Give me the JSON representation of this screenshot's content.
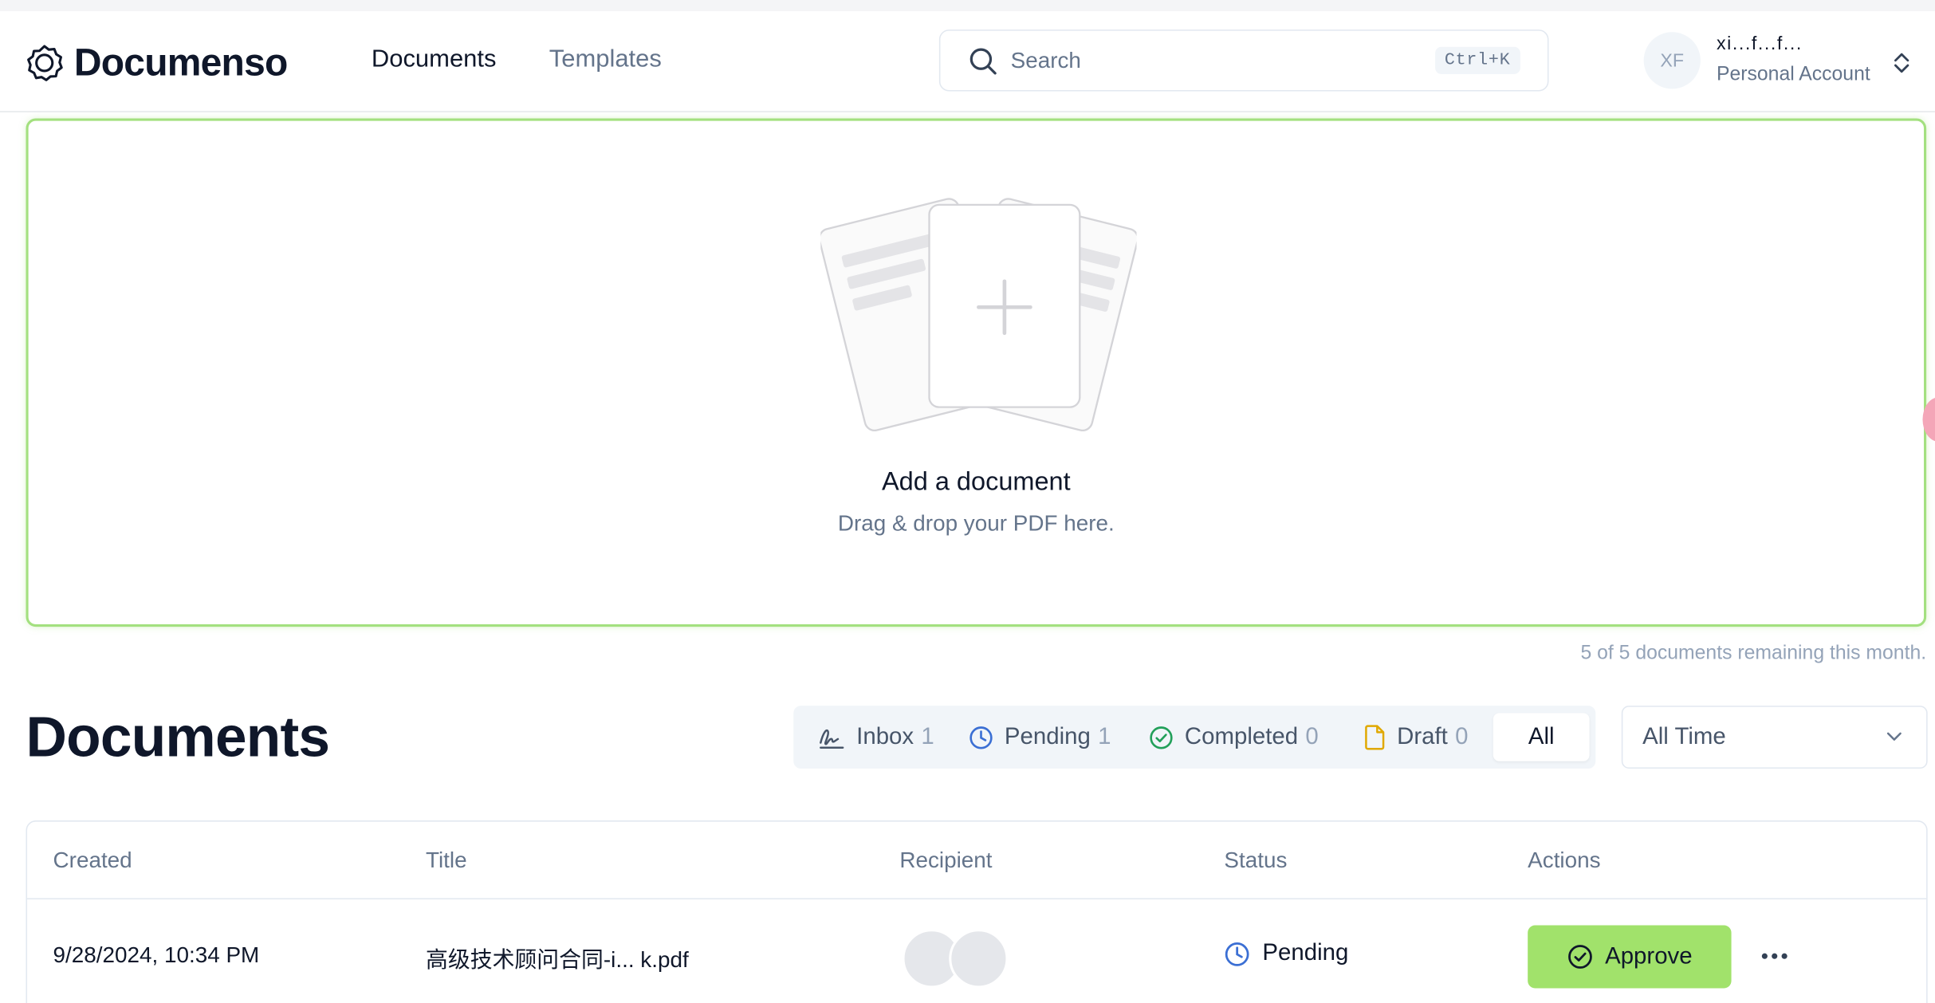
{
  "header": {
    "brand": "Documenso",
    "nav": {
      "documents": "Documents",
      "templates": "Templates"
    },
    "search": {
      "placeholder": "Search",
      "shortcut": "Ctrl+K"
    },
    "account": {
      "initials": "XF",
      "name": "xi...f...f...",
      "type": "Personal Account"
    }
  },
  "dropzone": {
    "title": "Add a document",
    "subtitle": "Drag & drop your PDF here."
  },
  "quota_text": "5 of 5 documents remaining this month.",
  "documents": {
    "heading": "Documents",
    "tabs": [
      {
        "label": "Inbox",
        "count": "1",
        "icon": "signature-icon"
      },
      {
        "label": "Pending",
        "count": "1",
        "icon": "clock-icon"
      },
      {
        "label": "Completed",
        "count": "0",
        "icon": "check-circle-icon"
      },
      {
        "label": "Draft",
        "count": "0",
        "icon": "file-icon"
      },
      {
        "label": "All",
        "active": true
      }
    ],
    "period": "All Time",
    "columns": {
      "created": "Created",
      "title": "Title",
      "recipient": "Recipient",
      "status": "Status",
      "actions": "Actions"
    },
    "rows": [
      {
        "created": "9/28/2024, 10:34 PM",
        "title": "高级技术顾问合同-i... k.pdf",
        "recipients": [
          "",
          ""
        ],
        "status": "Pending",
        "action": "Approve"
      }
    ]
  },
  "colors": {
    "accent": "#a1e26b",
    "pending_blue": "#3b6fd4",
    "completed_green": "#22a05a",
    "draft_amber": "#e0a800"
  }
}
